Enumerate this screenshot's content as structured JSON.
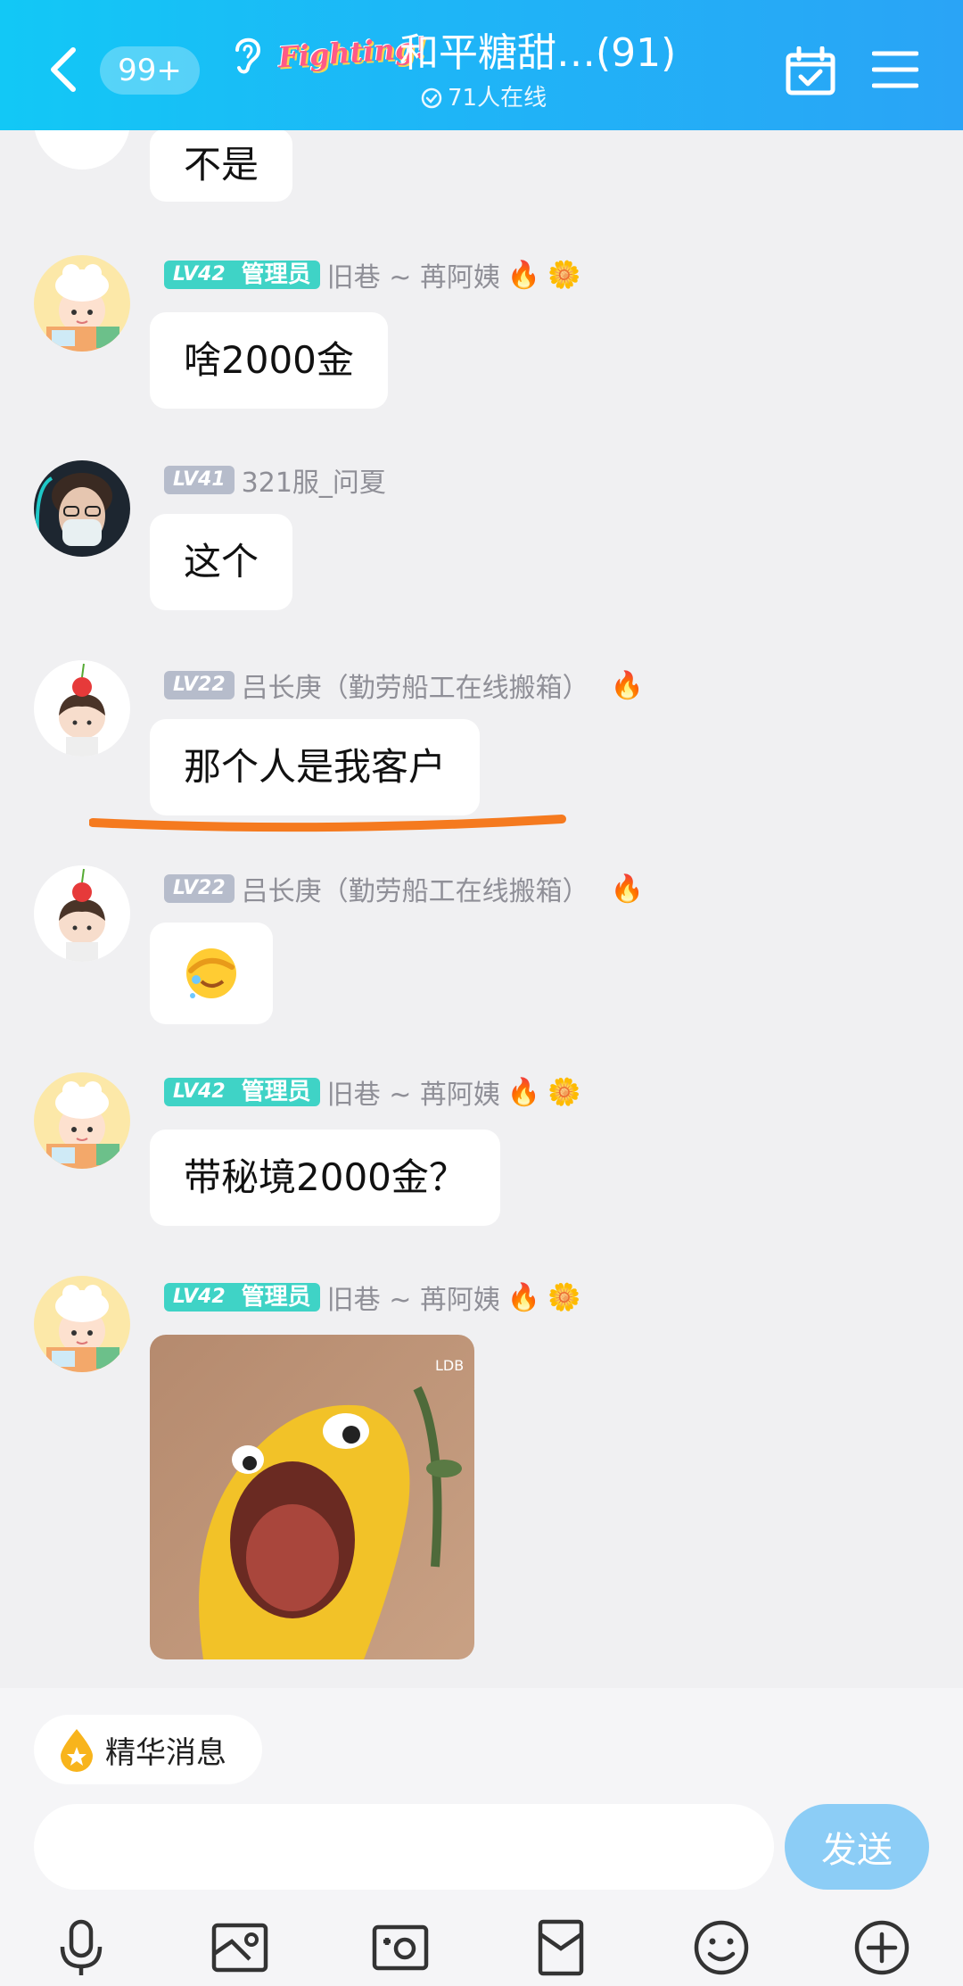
{
  "header": {
    "unread_badge": "99+",
    "logo_text": "Fighting!",
    "title": "和平糖甜…(91)",
    "online": "71人在线"
  },
  "messages": [
    {
      "text": "不是"
    },
    {
      "level": "LV42",
      "role": "管理员",
      "nick": "旧巷 ~ 苒阿姨",
      "text": "啥2000金"
    },
    {
      "level": "LV41",
      "nick": "321服_问夏",
      "text": "这个"
    },
    {
      "level": "LV22",
      "nick": "吕长庚（勤劳船工在线搬箱）",
      "text": "那个人是我客户"
    },
    {
      "level": "LV22",
      "nick": "吕长庚（勤劳船工在线搬箱）",
      "emoji": "facepalm-cry"
    },
    {
      "level": "LV42",
      "role": "管理员",
      "nick": "旧巷 ~ 苒阿姨",
      "text": "带秘境2000金？"
    },
    {
      "level": "LV42",
      "role": "管理员",
      "nick": "旧巷 ~ 苒阿姨",
      "sticker": "screaming-yellow-creature"
    }
  ],
  "bottom": {
    "essence_label": "精华消息",
    "input_placeholder": "",
    "send_label": "发送"
  },
  "toolbar": [
    "mic-icon",
    "image-icon",
    "camera-icon",
    "red-packet-icon",
    "emoji-icon",
    "plus-icon"
  ]
}
